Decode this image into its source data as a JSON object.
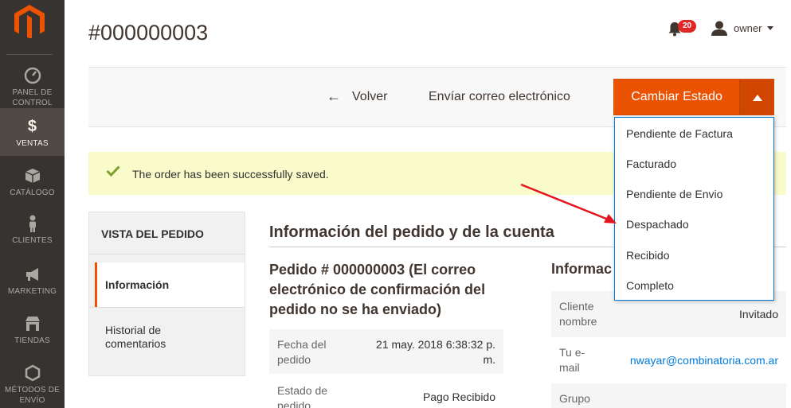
{
  "sidebar": {
    "items": [
      {
        "label": "PANEL DE\nCONTROL",
        "icon": "dashboard-icon"
      },
      {
        "label": "VENTAS",
        "icon": "dollar-icon",
        "active": true
      },
      {
        "label": "CATÁLOGO",
        "icon": "box-icon"
      },
      {
        "label": "CLIENTES",
        "icon": "person-icon"
      },
      {
        "label": "MARKETING",
        "icon": "megaphone-icon"
      },
      {
        "label": "TIENDAS",
        "icon": "store-icon"
      },
      {
        "label": "MÉTODOS DE\nENVÍO",
        "icon": "hexagon-icon"
      }
    ]
  },
  "header": {
    "title": "#000000003",
    "notifications_count": "20",
    "user_name": "owner"
  },
  "actions": {
    "back_label": "Volver",
    "email_label": "Envíar correo electrónico",
    "change_status_label": "Cambiar Estado"
  },
  "status_menu": {
    "options": [
      "Pendiente de Factura",
      "Facturado",
      "Pendiente de Envio",
      "Despachado",
      "Recibido",
      "Completo"
    ]
  },
  "message": {
    "text": "The order has been successfully saved."
  },
  "tabs": {
    "heading": "VISTA DEL PEDIDO",
    "items": [
      "Información",
      "Historial de comentarios"
    ]
  },
  "main": {
    "section_title": "Información del pedido y de la cuenta",
    "order_heading": "Pedido # 000000003 (El correo electrónico de confirmación del pedido no se ha enviado)",
    "order_rows": [
      {
        "label": "Fecha del pedido",
        "value": "21 may. 2018 6:38:32 p. m."
      },
      {
        "label": "Estado de pedido",
        "value": "Pago Recibido"
      }
    ],
    "account_title": "Informac",
    "account_rows": [
      {
        "label": "Cliente nombre",
        "value": "Invitado"
      },
      {
        "label": "Tu e-mail",
        "value": "nwayar@combinatoria.com.ar"
      },
      {
        "label": "Grupo",
        "value": ""
      }
    ]
  },
  "colors": {
    "sidebar_bg": "#373330",
    "accent": "#eb5202",
    "link": "#007bdb",
    "message_bg": "#fafbcb",
    "annotation": "#e3141b"
  }
}
